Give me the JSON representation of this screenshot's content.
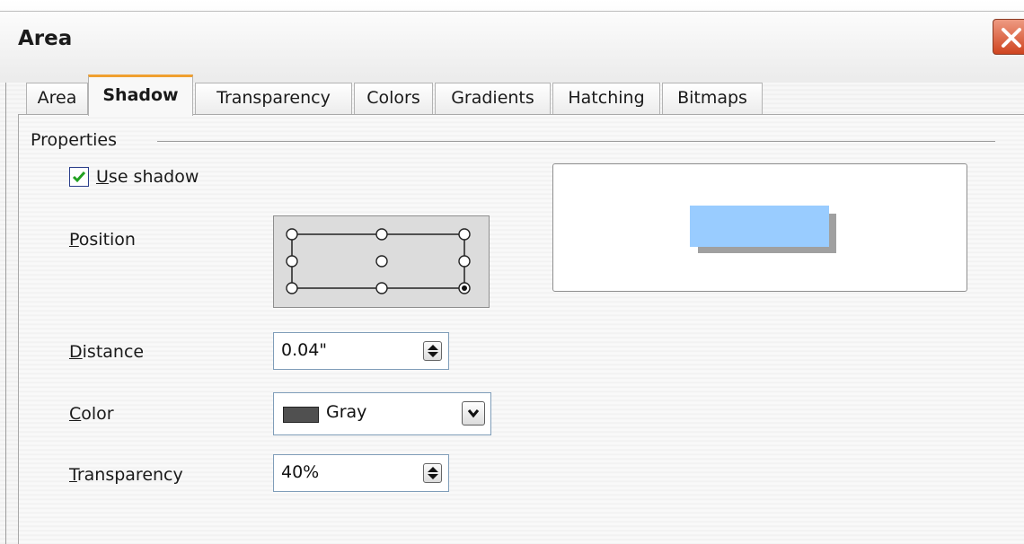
{
  "window": {
    "title": "Area"
  },
  "tabs": [
    {
      "label": "Area"
    },
    {
      "label": "Shadow",
      "active": true
    },
    {
      "label": "Transparency"
    },
    {
      "label": "Colors"
    },
    {
      "label": "Gradients"
    },
    {
      "label": "Hatching"
    },
    {
      "label": "Bitmaps"
    }
  ],
  "properties": {
    "group_label": "Properties",
    "use_shadow": {
      "label_u": "U",
      "label_rest": "se shadow",
      "checked": true
    },
    "position": {
      "label_u": "P",
      "label_rest": "osition",
      "selected": "bottom-right"
    },
    "distance": {
      "label_u": "D",
      "label_rest": "istance",
      "value": "0.04\""
    },
    "color": {
      "label_u": "C",
      "label_rest": "olor",
      "value": "Gray",
      "swatch": "#505050"
    },
    "transparency": {
      "label_u": "T",
      "label_rest": "ransparency",
      "value": "40%"
    }
  },
  "preview": {
    "fill_color": "#99ccff",
    "shadow_color": "#a0a0a0"
  },
  "icons": [
    "close-icon",
    "check-icon",
    "spin-arrows-icon",
    "chevron-down-icon"
  ]
}
